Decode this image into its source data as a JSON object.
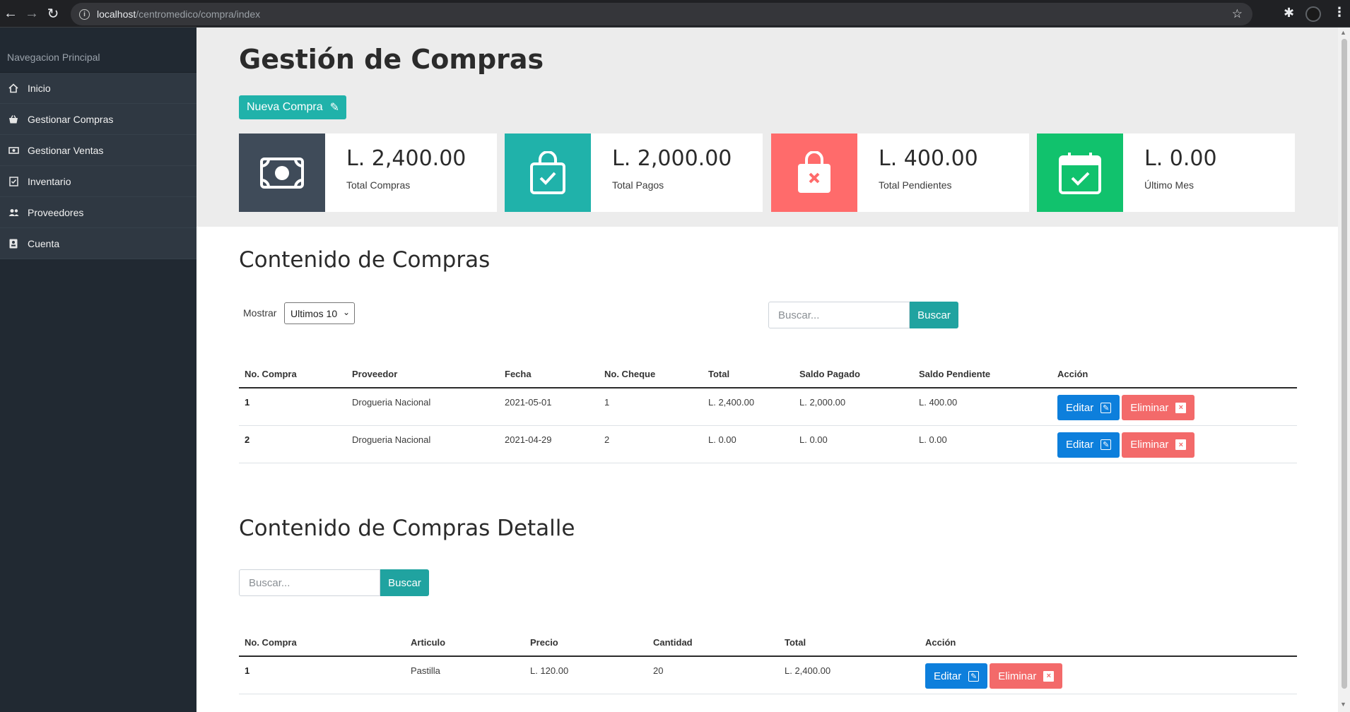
{
  "browser": {
    "url_host": "localhost",
    "url_path": "/centromedico/compra/index"
  },
  "sidebar": {
    "title": "Navegacion Principal",
    "items": [
      {
        "label": "Inicio",
        "icon": "home-icon"
      },
      {
        "label": "Gestionar Compras",
        "icon": "basket-icon"
      },
      {
        "label": "Gestionar Ventas",
        "icon": "money-icon"
      },
      {
        "label": "Inventario",
        "icon": "checklist-icon"
      },
      {
        "label": "Proveedores",
        "icon": "users-icon"
      },
      {
        "label": "Cuenta",
        "icon": "id-card-icon"
      }
    ]
  },
  "header": {
    "title": "Gestión de Compras",
    "new_button": "Nueva Compra"
  },
  "stats": [
    {
      "value": "L. 2,400.00",
      "label": "Total Compras",
      "color": "#3f4b59",
      "icon": "cash-icon"
    },
    {
      "value": "L. 2,000.00",
      "label": "Total Pagos",
      "color": "#20b2aa",
      "icon": "bag-check-icon"
    },
    {
      "value": "L. 400.00",
      "label": "Total Pendientes",
      "color": "#ff6b6b",
      "icon": "bag-x-icon"
    },
    {
      "value": "L. 0.00",
      "label": "Último Mes",
      "color": "#11c26d",
      "icon": "calendar-check-icon"
    }
  ],
  "compras": {
    "title": "Contenido de Compras",
    "show_label": "Mostrar",
    "show_value": "Ultimos 10",
    "search_placeholder": "Buscar...",
    "search_button": "Buscar",
    "columns": [
      "No. Compra",
      "Proveedor",
      "Fecha",
      "No. Cheque",
      "Total",
      "Saldo Pagado",
      "Saldo Pendiente",
      "Acción"
    ],
    "rows": [
      {
        "no": "1",
        "proveedor": "Drogueria Nacional",
        "fecha": "2021-05-01",
        "cheque": "1",
        "total": "L. 2,400.00",
        "pagado": "L. 2,000.00",
        "pendiente": "L. 400.00"
      },
      {
        "no": "2",
        "proveedor": "Drogueria Nacional",
        "fecha": "2021-04-29",
        "cheque": "2",
        "total": "L. 0.00",
        "pagado": "L. 0.00",
        "pendiente": "L. 0.00"
      }
    ],
    "edit_label": "Editar",
    "delete_label": "Eliminar"
  },
  "detalle": {
    "title": "Contenido de Compras Detalle",
    "search_placeholder": "Buscar...",
    "search_button": "Buscar",
    "columns": [
      "No. Compra",
      "Articulo",
      "Precio",
      "Cantidad",
      "Total",
      "Acción"
    ],
    "rows": [
      {
        "no": "1",
        "articulo": "Pastilla",
        "precio": "L. 120.00",
        "cantidad": "20",
        "total": "L. 2,400.00"
      }
    ],
    "edit_label": "Editar",
    "delete_label": "Eliminar"
  }
}
